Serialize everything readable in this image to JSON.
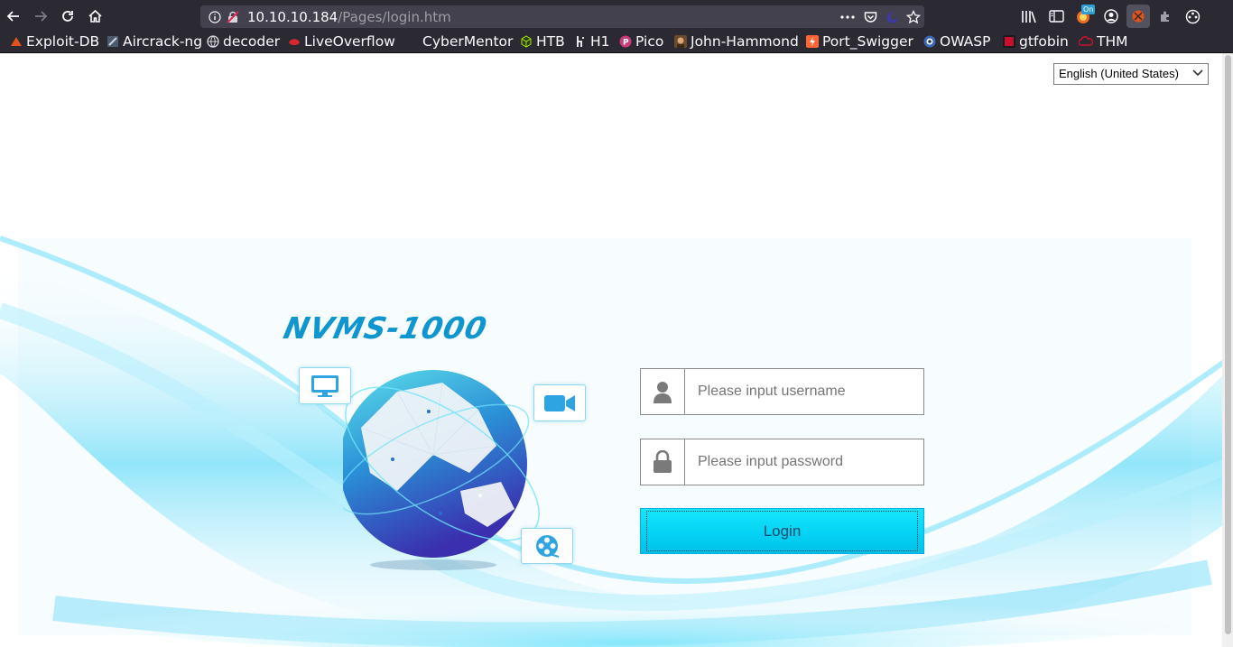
{
  "browser": {
    "url": {
      "host": "10.10.10.184",
      "path": "/Pages/login.htm"
    },
    "extension_badge": "On",
    "bookmarks": [
      {
        "label": "Exploit-DB",
        "icon": "exploit-db-icon",
        "color": "#e2531b"
      },
      {
        "label": "Aircrack-ng",
        "icon": "aircrack-icon",
        "color": "#5a6f86"
      },
      {
        "label": "decoder",
        "icon": "globe-icon",
        "color": "#cfcfd4"
      },
      {
        "label": "LiveOverflow",
        "icon": "liveoverflow-icon",
        "color": "#d8262e"
      },
      {
        "label": "CyberMentor",
        "icon": "cybermentor-icon",
        "color": "#2b2a33"
      },
      {
        "label": "HTB",
        "icon": "htb-cube-icon",
        "color": "#9fef00"
      },
      {
        "label": "H1",
        "icon": "hackerone-icon",
        "color": "#ffffff"
      },
      {
        "label": "Pico",
        "icon": "pico-icon",
        "color": "#c93c7b"
      },
      {
        "label": "John-Hammond",
        "icon": "avatar-icon",
        "color": "#b8865a"
      },
      {
        "label": "Port_Swigger",
        "icon": "portswigger-icon",
        "color": "#ff6633"
      },
      {
        "label": "OWASP",
        "icon": "owasp-icon",
        "color": "#3a68b5"
      },
      {
        "label": "gtfobin",
        "icon": "gtfobins-icon",
        "color": "#c8102e"
      },
      {
        "label": "THM",
        "icon": "thm-cloud-icon",
        "color": "#c8142c"
      }
    ]
  },
  "page": {
    "language": "English (United States)",
    "logo": "NVMS-1000",
    "username_placeholder": "Please input username",
    "password_placeholder": "Please input password",
    "login_label": "Login",
    "icons": [
      "monitor-icon",
      "video-camera-icon",
      "film-reel-icon",
      "globe-icon",
      "user-icon",
      "lock-icon"
    ],
    "accent": "#04d3f5"
  }
}
